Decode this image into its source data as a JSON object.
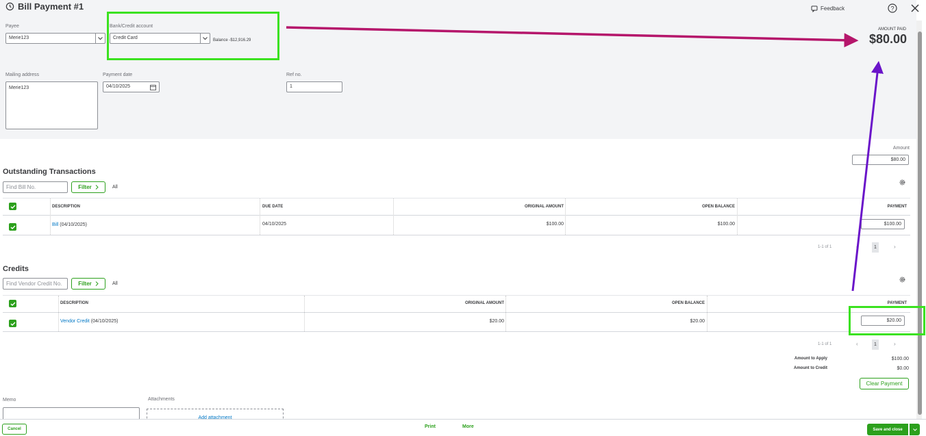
{
  "header": {
    "title": "Bill Payment #1",
    "feedback_label": "Feedback",
    "amount_paid_label": "AMOUNT PAID",
    "amount_paid_value": "$80.00"
  },
  "form": {
    "payee_label": "Payee",
    "payee_value": "Merie123",
    "bank_label": "Bank/Credit account",
    "bank_value": "Credit Card",
    "balance_text": "Balance -$12,916.29",
    "mailing_label": "Mailing address",
    "mailing_value": "Merie123",
    "payment_date_label": "Payment date",
    "payment_date_value": "04/10/2025",
    "ref_label": "Ref no.",
    "ref_value": "1",
    "amount_label": "Amount",
    "amount_value": "$80.00"
  },
  "outstanding": {
    "title": "Outstanding Transactions",
    "search_placeholder": "Find Bill No.",
    "filter_label": "Filter",
    "all_label": "All",
    "columns": [
      "DESCRIPTION",
      "DUE DATE",
      "ORIGINAL AMOUNT",
      "OPEN BALANCE",
      "PAYMENT"
    ],
    "rows": [
      {
        "desc_link": "Bill",
        "desc_rest": " (04/10/2025)",
        "due_date": "04/10/2025",
        "original": "$100.00",
        "open": "$100.00",
        "payment": "$100.00"
      }
    ],
    "pagination": "1-1 of 1",
    "page": "1"
  },
  "credits": {
    "title": "Credits",
    "search_placeholder": "Find Vendor Credit No.",
    "filter_label": "Filter",
    "all_label": "All",
    "columns": [
      "DESCRIPTION",
      "ORIGINAL AMOUNT",
      "OPEN BALANCE",
      "PAYMENT"
    ],
    "rows": [
      {
        "desc_link": "Vendor Credit",
        "desc_rest": " (04/10/2025)",
        "original": "$20.00",
        "open": "$20.00",
        "payment": "$20.00"
      }
    ],
    "pagination": "1-1 of 1",
    "page": "1"
  },
  "summary": {
    "apply_label": "Amount to Apply",
    "apply_value": "$100.00",
    "credit_label": "Amount to Credit",
    "credit_value": "$0.00",
    "clear_label": "Clear Payment"
  },
  "bottom": {
    "memo_label": "Memo",
    "attachments_label": "Attachments",
    "add_attachment": "Add attachment"
  },
  "footer": {
    "cancel": "Cancel",
    "print": "Print",
    "more": "More",
    "save": "Save and close"
  },
  "colors": {
    "green": "#2ca01c",
    "highlight_green": "#3be21f",
    "arrow_magenta": "#b5166b",
    "arrow_purple": "#6a14c9",
    "link": "#0077c5"
  }
}
